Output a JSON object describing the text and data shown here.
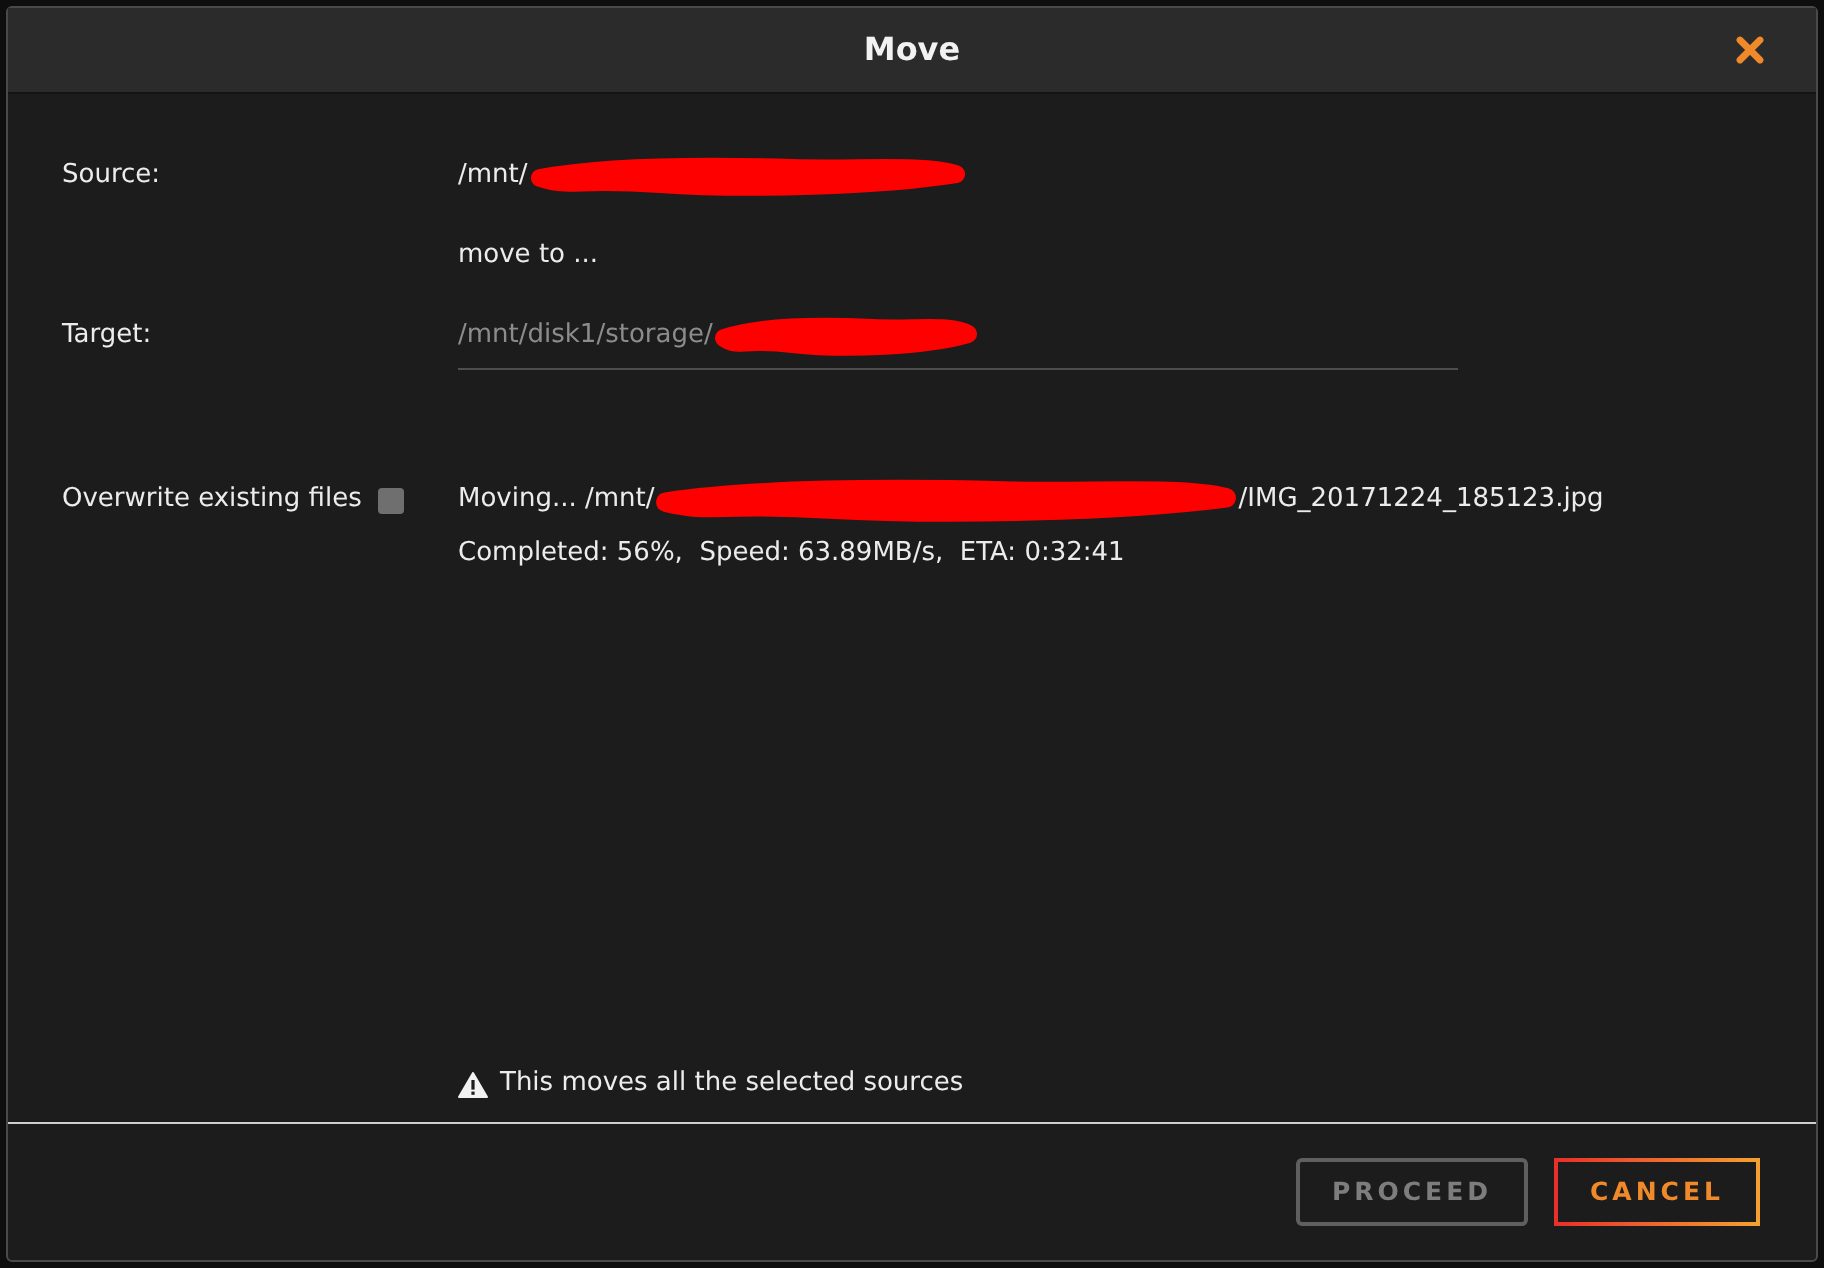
{
  "window": {
    "title": "Move"
  },
  "source": {
    "label": "Source:",
    "value": "/mnt/",
    "redacted": true
  },
  "connector_text": "move to ...",
  "target": {
    "label": "Target:",
    "value": "/mnt/disk1/storage/",
    "redacted": true
  },
  "overwrite": {
    "label": "Overwrite existing files",
    "checked": false
  },
  "progress": {
    "file_prefix": "Moving... /mnt/",
    "redacted": true,
    "file_suffix": "/IMG_20171224_185123.jpg",
    "status": "Completed: 56%,  Speed: 63.89MB/s,  ETA: 0:32:41"
  },
  "warning": "This moves all the selected sources",
  "buttons": [
    {
      "label": "PROCEED",
      "kind": "secondary",
      "disabled": true
    },
    {
      "label": "CANCEL",
      "kind": "primary",
      "disabled": false
    }
  ]
}
